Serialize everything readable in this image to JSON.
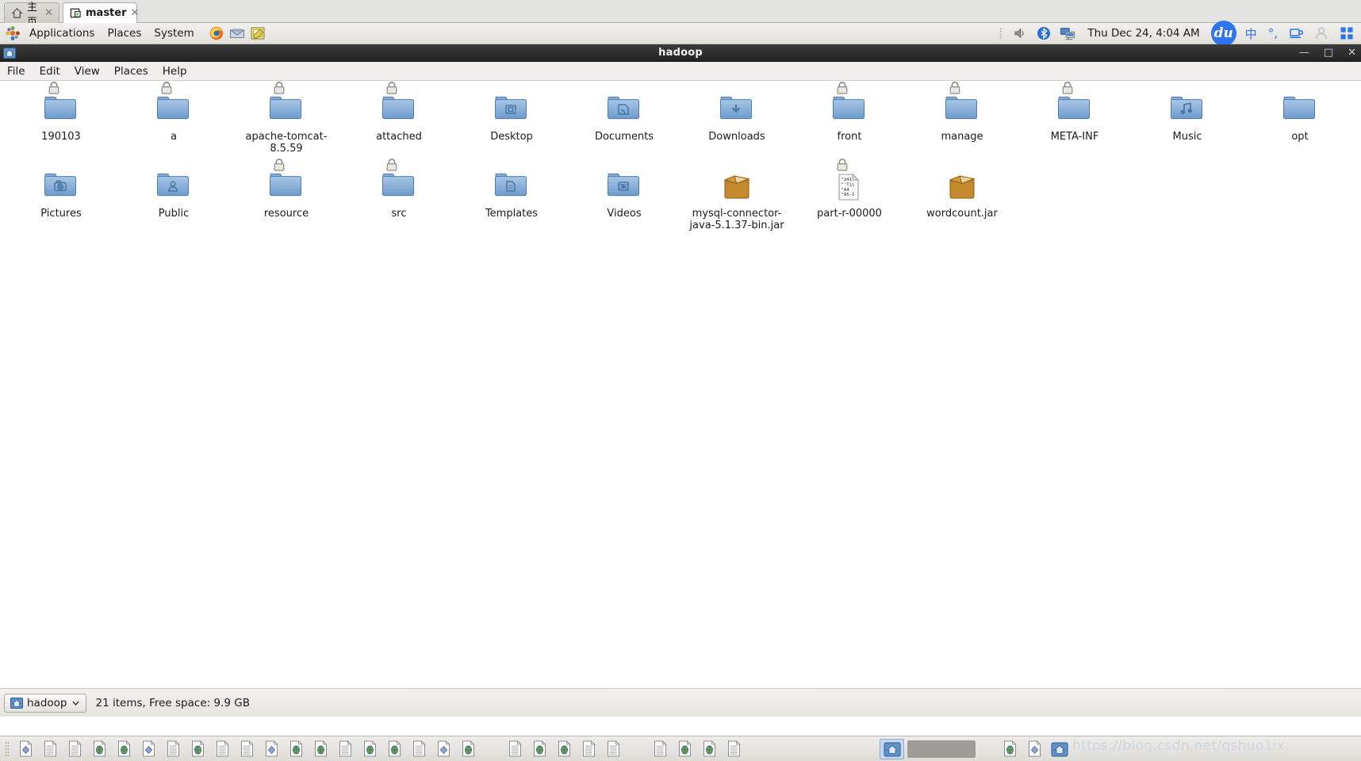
{
  "tabs": [
    {
      "label": "主页",
      "icon": "home-icon",
      "active": false
    },
    {
      "label": "master",
      "icon": "vm-icon",
      "active": true
    }
  ],
  "panel": {
    "menus": [
      "Applications",
      "Places",
      "System"
    ],
    "launchers": [
      "firefox-icon",
      "email-icon",
      "text-editor-icon"
    ],
    "tray": [
      "volume-icon",
      "bluetooth-icon",
      "network-icon"
    ],
    "clock": "Thu Dec 24,  4:04 AM",
    "badge": "du",
    "ime": [
      "中",
      "°,",
      "tray-cup-icon",
      "tray-user-icon",
      "tray-apps-icon"
    ]
  },
  "window": {
    "title": "hadoop",
    "icon": "home-folder-icon",
    "controls": {
      "minimize": "—",
      "maximize": "□",
      "close": "✕"
    },
    "menubar": [
      "File",
      "Edit",
      "View",
      "Places",
      "Help"
    ]
  },
  "files": [
    {
      "name": "190103",
      "type": "folder",
      "emblem": "lock-icon"
    },
    {
      "name": "a",
      "type": "folder",
      "emblem": "lock-icon"
    },
    {
      "name": "apache-tomcat-8.5.59",
      "type": "folder",
      "emblem": "lock-icon"
    },
    {
      "name": "attached",
      "type": "folder",
      "emblem": "lock-icon"
    },
    {
      "name": "Desktop",
      "type": "folder-desktop",
      "emblem": null
    },
    {
      "name": "Documents",
      "type": "folder-documents",
      "emblem": null
    },
    {
      "name": "Downloads",
      "type": "folder-downloads",
      "emblem": null
    },
    {
      "name": "front",
      "type": "folder",
      "emblem": "lock-icon"
    },
    {
      "name": "manage",
      "type": "folder",
      "emblem": "lock-icon"
    },
    {
      "name": "META-INF",
      "type": "folder",
      "emblem": "lock-icon"
    },
    {
      "name": "Music",
      "type": "folder-music",
      "emblem": null
    },
    {
      "name": "opt",
      "type": "folder",
      "emblem": null
    },
    {
      "name": "Pictures",
      "type": "folder-pictures",
      "emblem": null
    },
    {
      "name": "Public",
      "type": "folder-public",
      "emblem": null
    },
    {
      "name": "resource",
      "type": "folder",
      "emblem": "lock-icon"
    },
    {
      "name": "src",
      "type": "folder",
      "emblem": "lock-icon"
    },
    {
      "name": "Templates",
      "type": "folder-templates",
      "emblem": null
    },
    {
      "name": "Videos",
      "type": "folder-videos",
      "emblem": null
    },
    {
      "name": "mysql-connector-java-5.1.37-bin.jar",
      "type": "archive",
      "emblem": null
    },
    {
      "name": "part-r-00000",
      "type": "text",
      "emblem": "lock-icon",
      "preview": [
        "\"241",
        "\"'Tis",
        "\"A4",
        "\"A5-I"
      ]
    },
    {
      "name": "wordcount.jar",
      "type": "archive",
      "emblem": null
    }
  ],
  "statusbar": {
    "path_label": "hadoop",
    "path_icon": "home-folder-icon",
    "dropdown_icon": "chevron-down-icon",
    "status": "21 items, Free space: 9.9 GB"
  },
  "taskbar": {
    "items": [
      "doc-diamond",
      "doc-plain",
      "doc-lines",
      "doc-globe",
      "doc-globe",
      "doc-diamond",
      "doc-lines",
      "doc-globe",
      "doc-plain",
      "doc-lines",
      "doc-diamond",
      "doc-globe",
      "doc-globe",
      "doc-lines",
      "doc-globe",
      "doc-globe",
      "doc-lines",
      "doc-diamond",
      "doc-globe"
    ],
    "items2": [
      "doc-lines",
      "doc-globe",
      "doc-globe",
      "doc-lines",
      "doc-lines"
    ],
    "items3": [
      "doc-lines",
      "doc-globe",
      "doc-globe",
      "doc-lines"
    ],
    "selected": "file-manager-icon",
    "right_items": [
      "doc-globe",
      "doc-diamond",
      "file-manager-icon"
    ]
  },
  "watermark": "https://blog.csdn.net/qshuo1ix",
  "colors": {
    "folder": "#7ba3d0",
    "folder_dark": "#5d86b5",
    "archive": "#c8882a",
    "accent": "#2c74f0",
    "titlebar": "#2a2a2a"
  }
}
